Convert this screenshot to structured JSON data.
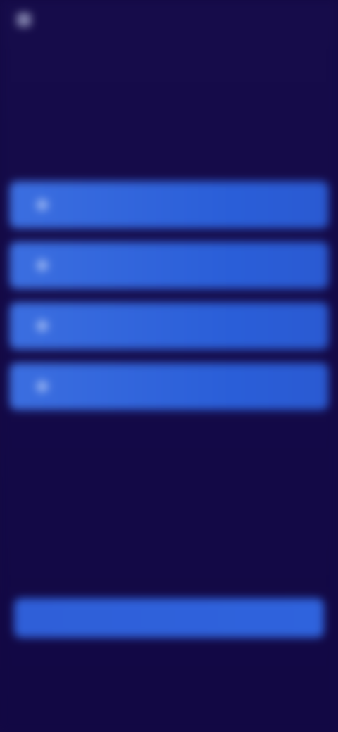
{
  "topbar": {
    "brand": "",
    "right_text": ""
  },
  "header": {
    "title": "",
    "subtitle": ""
  },
  "options": [
    {
      "label": ""
    },
    {
      "label": ""
    },
    {
      "label": ""
    },
    {
      "label": ""
    }
  ],
  "links": {
    "secondary": "",
    "small_label": "",
    "bottom": ""
  },
  "primary_button": {
    "label": ""
  },
  "colors": {
    "background": "#140a44",
    "option": "#2f63dd",
    "primary": "#2f5fd8"
  }
}
